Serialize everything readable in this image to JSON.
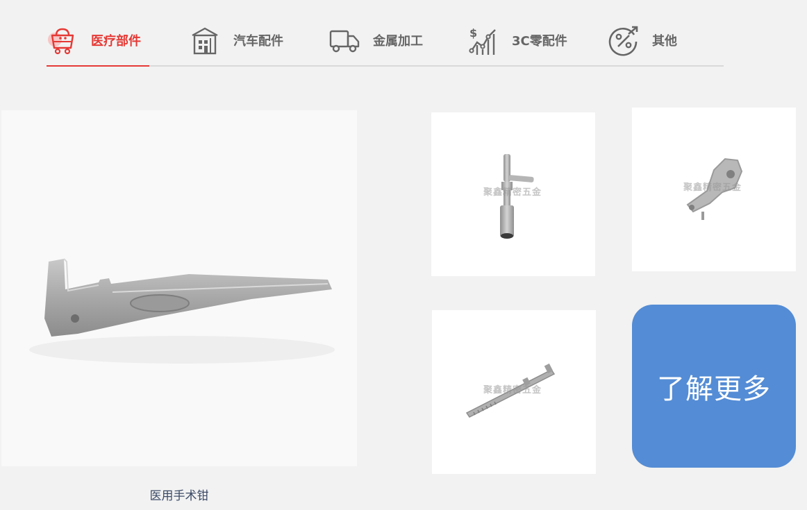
{
  "tabs": [
    {
      "label": "医疗部件",
      "icon": "shopping-cart-icon",
      "active": true
    },
    {
      "label": "汽车配件",
      "icon": "building-icon",
      "active": false
    },
    {
      "label": "金属加工",
      "icon": "truck-icon",
      "active": false
    },
    {
      "label": "3C零配件",
      "icon": "chart-dollar-icon",
      "active": false
    },
    {
      "label": "其他",
      "icon": "percent-icon",
      "active": false
    }
  ],
  "colors": {
    "accent": "#e53935",
    "button": "#548cd5",
    "background": "#f2f2f2"
  },
  "featured": {
    "caption": "医用手术钳"
  },
  "products": [
    {
      "watermark": "聚鑫精密五金"
    },
    {
      "watermark": "聚鑫精密五金"
    },
    {
      "watermark": "聚鑫精密五金"
    }
  ],
  "more_button": {
    "label": "了解更多"
  }
}
